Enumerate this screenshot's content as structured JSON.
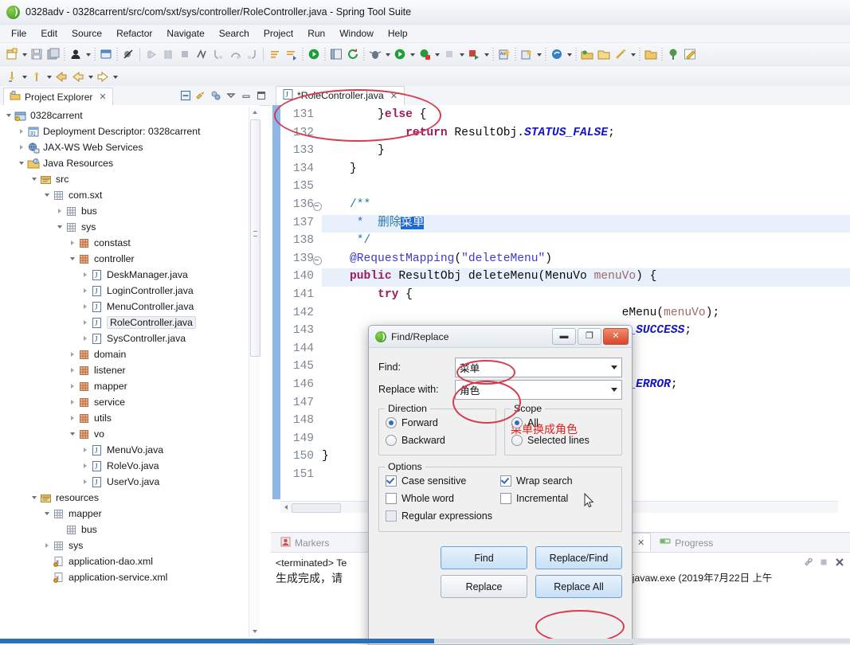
{
  "window": {
    "title": "0328adv - 0328carrent/src/com/sxt/sys/controller/RoleController.java - Spring Tool Suite",
    "logo_icon": "spring-leaf-icon"
  },
  "menu": [
    "File",
    "Edit",
    "Source",
    "Refactor",
    "Navigate",
    "Search",
    "Project",
    "Run",
    "Window",
    "Help"
  ],
  "project_explorer": {
    "tab_label": "Project Explorer",
    "close_icon": "close-icon",
    "toolbar_icons": [
      "collapse-all-icon",
      "link-with-editor-icon",
      "view-filters-icon",
      "view-menu-icon",
      "minimize-icon",
      "maximize-icon"
    ],
    "tree": [
      {
        "label": "0328carrent",
        "depth": 0,
        "arrow": "open",
        "icon": "project-icon"
      },
      {
        "label": "Deployment Descriptor: 0328carrent",
        "depth": 1,
        "arrow": "closed",
        "icon": "deployment-descriptor-icon"
      },
      {
        "label": "JAX-WS Web Services",
        "depth": 1,
        "arrow": "closed",
        "icon": "web-services-icon"
      },
      {
        "label": "Java Resources",
        "depth": 1,
        "arrow": "open",
        "icon": "java-resources-icon"
      },
      {
        "label": "src",
        "depth": 2,
        "arrow": "open",
        "icon": "source-folder-icon"
      },
      {
        "label": "com.sxt",
        "depth": 3,
        "arrow": "open",
        "icon": "package-icon"
      },
      {
        "label": "bus",
        "depth": 4,
        "arrow": "closed",
        "icon": "package-icon"
      },
      {
        "label": "sys",
        "depth": 4,
        "arrow": "open",
        "icon": "package-icon"
      },
      {
        "label": "constast",
        "depth": 5,
        "arrow": "closed",
        "icon": "package-full-icon"
      },
      {
        "label": "controller",
        "depth": 5,
        "arrow": "open",
        "icon": "package-full-icon"
      },
      {
        "label": "DeskManager.java",
        "depth": 6,
        "arrow": "closed",
        "icon": "java-file-icon"
      },
      {
        "label": "LoginController.java",
        "depth": 6,
        "arrow": "closed",
        "icon": "java-file-icon"
      },
      {
        "label": "MenuController.java",
        "depth": 6,
        "arrow": "closed",
        "icon": "java-file-icon"
      },
      {
        "label": "RoleController.java",
        "depth": 6,
        "arrow": "closed",
        "icon": "java-file-icon",
        "selected": true
      },
      {
        "label": "SysController.java",
        "depth": 6,
        "arrow": "closed",
        "icon": "java-file-icon"
      },
      {
        "label": "domain",
        "depth": 5,
        "arrow": "closed",
        "icon": "package-full-icon"
      },
      {
        "label": "listener",
        "depth": 5,
        "arrow": "closed",
        "icon": "package-full-icon"
      },
      {
        "label": "mapper",
        "depth": 5,
        "arrow": "closed",
        "icon": "package-full-icon"
      },
      {
        "label": "service",
        "depth": 5,
        "arrow": "closed",
        "icon": "package-full-icon"
      },
      {
        "label": "utils",
        "depth": 5,
        "arrow": "closed",
        "icon": "package-full-icon"
      },
      {
        "label": "vo",
        "depth": 5,
        "arrow": "open",
        "icon": "package-full-icon"
      },
      {
        "label": "MenuVo.java",
        "depth": 6,
        "arrow": "closed",
        "icon": "java-file-icon"
      },
      {
        "label": "RoleVo.java",
        "depth": 6,
        "arrow": "closed",
        "icon": "java-file-icon"
      },
      {
        "label": "UserVo.java",
        "depth": 6,
        "arrow": "closed",
        "icon": "java-file-icon"
      },
      {
        "label": "resources",
        "depth": 2,
        "arrow": "open",
        "icon": "source-folder-icon"
      },
      {
        "label": "mapper",
        "depth": 3,
        "arrow": "open",
        "icon": "package-icon"
      },
      {
        "label": "bus",
        "depth": 4,
        "arrow": "none",
        "icon": "package-icon"
      },
      {
        "label": "sys",
        "depth": 3,
        "arrow": "closed",
        "icon": "package-icon"
      },
      {
        "label": "application-dao.xml",
        "depth": 3,
        "arrow": "none",
        "icon": "xml-file-icon"
      },
      {
        "label": "application-service.xml",
        "depth": 3,
        "arrow": "none",
        "icon": "xml-file-icon"
      }
    ]
  },
  "editor": {
    "tab_label": "*RoleController.java",
    "tab_icon": "java-file-icon",
    "close_icon": "close-icon",
    "lines": [
      {
        "n": "131",
        "fold": false,
        "html": "        }else {"
      },
      {
        "n": "132",
        "fold": false,
        "html": "            return ResultObj.STATUS_FALSE;"
      },
      {
        "n": "133",
        "fold": false,
        "html": "        }"
      },
      {
        "n": "134",
        "fold": false,
        "html": "    }"
      },
      {
        "n": "135",
        "fold": false,
        "html": ""
      },
      {
        "n": "136",
        "fold": true,
        "html": "    /**"
      },
      {
        "n": "137",
        "fold": false,
        "html": "     * 删除菜单"
      },
      {
        "n": "138",
        "fold": false,
        "html": "     */"
      },
      {
        "n": "139",
        "fold": true,
        "html": "    @RequestMapping(\"deleteMenu\")"
      },
      {
        "n": "140",
        "fold": false,
        "html": "    public ResultObj deleteMenu(MenuVo menuVo) {"
      },
      {
        "n": "141",
        "fold": false,
        "html": "        try {"
      },
      {
        "n": "142",
        "fold": false,
        "html": "            ...deleteMenu(menuVo);"
      },
      {
        "n": "143",
        "fold": false,
        "html": "            ...E_SUCCESS;"
      },
      {
        "n": "144",
        "fold": false,
        "html": ""
      },
      {
        "n": "145",
        "fold": false,
        "html": ""
      },
      {
        "n": "146",
        "fold": false,
        "html": "            ...E_ERROR;"
      },
      {
        "n": "147",
        "fold": false,
        "html": ""
      },
      {
        "n": "148",
        "fold": false,
        "html": ""
      },
      {
        "n": "149",
        "fold": false,
        "html": ""
      },
      {
        "n": "150",
        "fold": false,
        "html": "}"
      },
      {
        "n": "151",
        "fold": false,
        "html": ""
      }
    ],
    "selected_text": "菜单"
  },
  "markers_view": {
    "tab_label": "Markers",
    "tab_icon": "markers-icon"
  },
  "console_view": {
    "tabs": [
      {
        "label": "Console",
        "icon": "console-icon",
        "active": true,
        "close_icon": "close-icon"
      },
      {
        "label": "Progress",
        "icon": "progress-icon",
        "active": false
      }
    ],
    "toolbar_icons": [
      "link-icon",
      "terminate-icon",
      "remove-icon"
    ],
    "terminated_line": "<terminated> Te",
    "terminated_right": ".8.0_181\\bin\\javaw.exe (2019年7月22日 上午",
    "output_line": "生成完成，请"
  },
  "find_replace": {
    "title": "Find/Replace",
    "app_icon": "spring-leaf-icon",
    "minimize_icon": "minimize-icon",
    "maximize_icon": "maximize-icon",
    "close_icon": "close-icon",
    "find_label": "Find:",
    "find_value": "菜单",
    "replace_label": "Replace with:",
    "replace_value": "角色",
    "annotation": "菜单换成角色",
    "annotation_color": "#e02020",
    "direction": {
      "title": "Direction",
      "options": [
        {
          "label": "Forward",
          "selected": true
        },
        {
          "label": "Backward",
          "selected": false
        }
      ]
    },
    "scope": {
      "title": "Scope",
      "options": [
        {
          "label": "All",
          "selected": true
        },
        {
          "label": "Selected lines",
          "selected": false
        }
      ]
    },
    "options": {
      "title": "Options",
      "items": [
        {
          "label": "Case sensitive",
          "checked": true,
          "disabled": false
        },
        {
          "label": "Wrap search",
          "checked": true,
          "disabled": false
        },
        {
          "label": "Whole word",
          "checked": false,
          "disabled": false
        },
        {
          "label": "Incremental",
          "checked": false,
          "disabled": false
        },
        {
          "label": "Regular expressions",
          "checked": false,
          "disabled": true
        }
      ]
    },
    "buttons": [
      {
        "label": "Find",
        "style": "primary"
      },
      {
        "label": "Replace/Find",
        "style": "primary"
      },
      {
        "label": "Replace",
        "style": "normal"
      },
      {
        "label": "Replace All",
        "style": "primary",
        "highlighted": true
      }
    ]
  },
  "annotations": {
    "accent": "#d63b4f",
    "ellipses": [
      "editor-tab",
      "find-field",
      "replace-field",
      "replace-all-button"
    ]
  }
}
